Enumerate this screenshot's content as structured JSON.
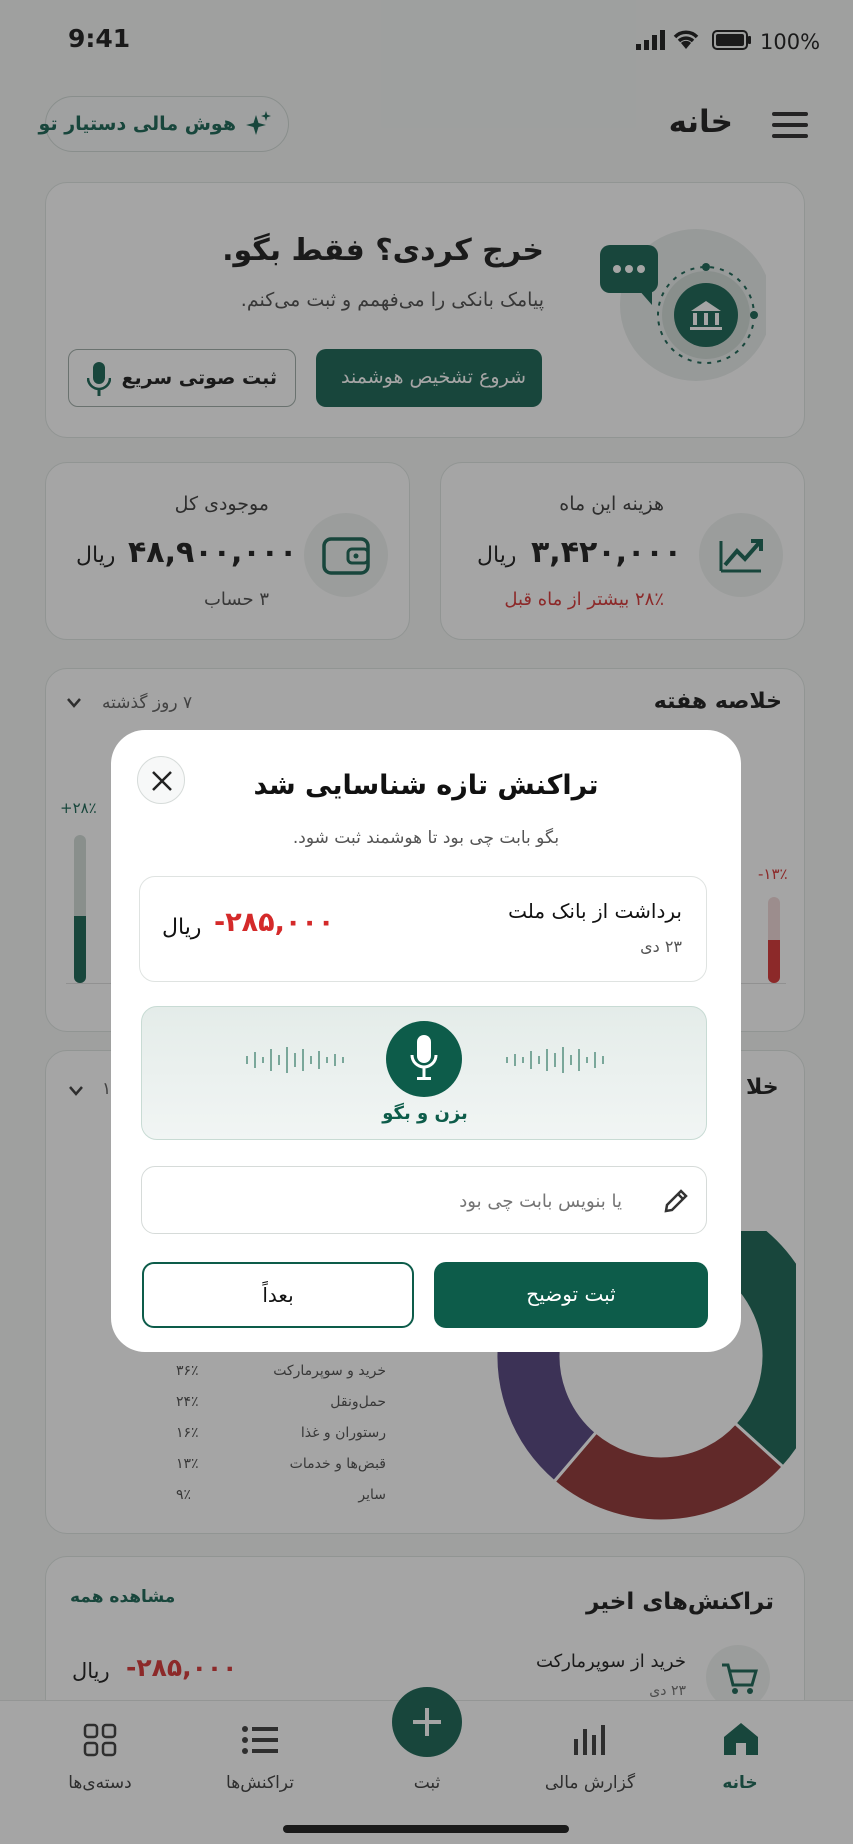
{
  "status_bar": {
    "time": "9:41",
    "battery": "100%"
  },
  "header": {
    "title": "خانه",
    "assistant_chip": "هوش مالی دستیار تو"
  },
  "hero": {
    "title": "خرج کردی؟ فقط بگو.",
    "subtitle": "پیامک بانکی را می‌فهمم و ثبت می‌کنم.",
    "primary_button": "شروع تشخیص هوشمند",
    "secondary_button": "ثبت صوتی سریع"
  },
  "stats": {
    "expense": {
      "label": "هزینه این ماه",
      "value": "۳,۴۲۰,۰۰۰",
      "unit": "ریال",
      "delta": "۲۸٪ بیشتر از ماه قبل"
    },
    "balance": {
      "label": "موجودی کل",
      "value": "۴۸,۹۰۰,۰۰۰",
      "unit": "ریال",
      "accounts": "۳ حساب"
    }
  },
  "weekly": {
    "title": "خلاصه هفته",
    "range": "۷ روز گذشته",
    "left_delta": "+۲۸٪",
    "right_delta": "-۱۳٪",
    "progress_left": 0.45,
    "progress_right": 0.5
  },
  "categories": {
    "title_partial": "خلا",
    "range_partial": "۱",
    "items": [
      {
        "name": "خرید و سوپرمارکت",
        "pct": "۳۶٪",
        "value": 36,
        "color": "#0d5c4a"
      },
      {
        "name": "حمل‌ونقل",
        "pct": "۲۴٪",
        "value": 24,
        "color": "#8b2a2a"
      },
      {
        "name": "رستوران و غذا",
        "pct": "۱۶٪",
        "value": 16,
        "color": "#4b3a78"
      },
      {
        "name": "قبض‌ها و خدمات",
        "pct": "۱۳٪",
        "value": 13,
        "color": "#a8682a"
      },
      {
        "name": "سایر",
        "pct": "۹٪",
        "value": 9,
        "color": "#7a7a7a"
      }
    ]
  },
  "recent": {
    "title": "تراکنش‌های اخیر",
    "see_all": "مشاهده همه",
    "item": {
      "title": "خرید از سوپرمارکت",
      "date": "۲۳ دی",
      "amount": "-۲۸۵,۰۰۰",
      "unit": "ریال"
    }
  },
  "bottom_nav": {
    "home": "خانه",
    "report": "گزارش مالی",
    "add": "ثبت",
    "transactions": "تراکنش‌ها",
    "categories": "دسته‌ی‌ها"
  },
  "modal": {
    "title": "تراکنش تازه شناسایی شد",
    "subtitle": "بگو بابت چی بود تا هوشمند ثبت شود.",
    "transaction": {
      "title": "برداشت از بانک ملت",
      "date": "۲۳ دی",
      "amount": "-۲۸۵,۰۰۰",
      "unit": "ریال"
    },
    "voice_label": "بزن و بگو",
    "input_placeholder": "یا بنویس بابت چی بود",
    "confirm_button": "ثبت توضیح",
    "later_button": "بعداً"
  },
  "colors": {
    "brand": "#0d5c4a",
    "negative": "#d42a2a"
  }
}
